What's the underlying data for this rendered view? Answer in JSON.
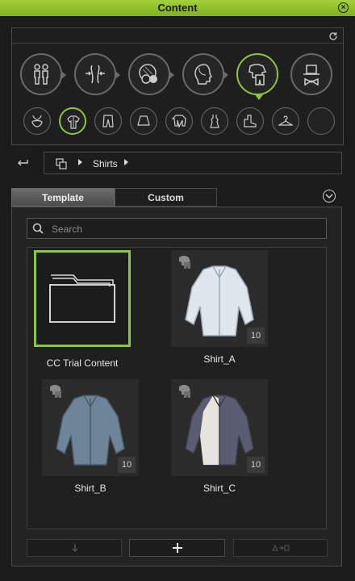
{
  "window": {
    "title": "Content"
  },
  "categories": [
    {
      "name": "body",
      "icon": "body-icon",
      "active": false
    },
    {
      "name": "morph",
      "icon": "morph-icon",
      "active": false
    },
    {
      "name": "skin",
      "icon": "skin-icon",
      "active": false
    },
    {
      "name": "head",
      "icon": "head-icon",
      "active": false
    },
    {
      "name": "clothing",
      "icon": "clothing-icon",
      "active": true
    },
    {
      "name": "accessory",
      "icon": "accessory-icon",
      "active": false
    }
  ],
  "subcategories": [
    {
      "icon": "underwear-icon",
      "active": false
    },
    {
      "icon": "shirt-icon",
      "active": true
    },
    {
      "icon": "pants-icon",
      "active": false
    },
    {
      "icon": "skirt-icon",
      "active": false
    },
    {
      "icon": "jacket-icon",
      "active": false
    },
    {
      "icon": "dress-icon",
      "active": false
    },
    {
      "icon": "shoes-icon",
      "active": false
    },
    {
      "icon": "hanger-icon",
      "active": false
    },
    {
      "icon": "empty-slot-icon",
      "active": false
    }
  ],
  "breadcrumb": {
    "current": "Shirts"
  },
  "tabs": {
    "template": "Template",
    "custom": "Custom",
    "active": "template"
  },
  "search": {
    "placeholder": "Search",
    "value": ""
  },
  "items": [
    {
      "label": "CC Trial Content",
      "count": null,
      "selected": true,
      "type": "folder"
    },
    {
      "label": "Shirt_A",
      "count": "10",
      "selected": false,
      "color": "#dfe6ec"
    },
    {
      "label": "Shirt_B",
      "count": "10",
      "selected": false,
      "color": "#6e8498"
    },
    {
      "label": "Shirt_C",
      "count": "10",
      "selected": false,
      "color": "#5a5d72"
    }
  ],
  "toolbar": {
    "down_icon": "arrow-down-icon",
    "add_icon": "plus-icon",
    "apply_icon": "apply-icon"
  },
  "colors": {
    "accent": "#8cc63f",
    "titlebar": "#8cc63f",
    "background": "#1b1b1b"
  }
}
